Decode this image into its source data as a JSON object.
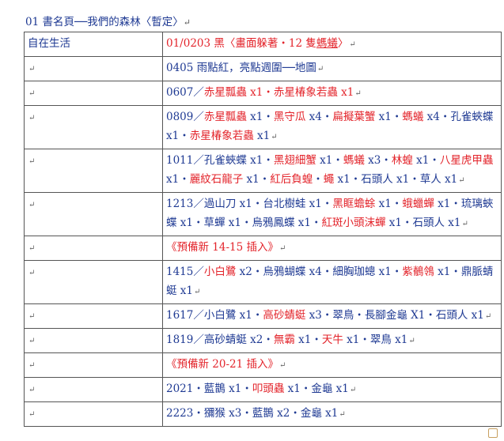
{
  "title": "01 書名頁──我們的森林〈暫定〉",
  "return_mark": "↵",
  "row_left": "自在生活",
  "rows": [
    {
      "type": "content",
      "segments": [
        {
          "t": "01/0203 ",
          "c": "red"
        },
        {
          "t": "黑〈畫面躲著・12 隻",
          "c": "red"
        },
        {
          "t": "螞蟻",
          "c": "red",
          "u": true
        },
        {
          "t": "〉",
          "c": "red"
        }
      ]
    },
    {
      "type": "content",
      "segments": [
        {
          "t": "0405 雨點紅，亮點週圍──地圖",
          "c": "blue"
        }
      ]
    },
    {
      "type": "content",
      "segments": [
        {
          "t": "0607／",
          "c": "blue"
        },
        {
          "t": "赤星瓢蟲 x1・赤星椿象若蟲 x1",
          "c": "red"
        }
      ]
    },
    {
      "type": "content",
      "segments": [
        {
          "t": "0809／",
          "c": "blue"
        },
        {
          "t": "赤星瓢蟲",
          "c": "red"
        },
        {
          "t": " x1・",
          "c": "blue"
        },
        {
          "t": "黑守瓜",
          "c": "red"
        },
        {
          "t": " x4・",
          "c": "blue"
        },
        {
          "t": "扁擬葉蟹",
          "c": "red"
        },
        {
          "t": " x1・",
          "c": "blue"
        },
        {
          "t": "螞蟻",
          "c": "red"
        },
        {
          "t": " x4・孔雀蛺蝶 x1・",
          "c": "blue"
        },
        {
          "t": "赤星椿象若蟲",
          "c": "red"
        },
        {
          "t": " x1",
          "c": "blue"
        }
      ]
    },
    {
      "type": "content",
      "segments": [
        {
          "t": "1011／孔雀蛺蝶 x1・",
          "c": "blue"
        },
        {
          "t": "黑翅細蟹",
          "c": "red"
        },
        {
          "t": " x1・",
          "c": "blue"
        },
        {
          "t": "螞蟻",
          "c": "red"
        },
        {
          "t": " x3・",
          "c": "blue"
        },
        {
          "t": "林蝗",
          "c": "red"
        },
        {
          "t": " x1・",
          "c": "blue"
        },
        {
          "t": "八星虎甲蟲",
          "c": "red"
        },
        {
          "t": " x1・",
          "c": "blue"
        },
        {
          "t": "麗紋石龍子",
          "c": "red"
        },
        {
          "t": " x1・",
          "c": "blue"
        },
        {
          "t": "紅后負蝗",
          "c": "red"
        },
        {
          "t": "・",
          "c": "blue"
        },
        {
          "t": "蠅",
          "c": "red"
        },
        {
          "t": " x1・石頭人 x1・草人 x1",
          "c": "blue"
        }
      ]
    },
    {
      "type": "content",
      "segments": [
        {
          "t": "1213／過山刀 x1・台北樹蛙 x1・",
          "c": "blue"
        },
        {
          "t": "黑眶蟾蜍",
          "c": "red"
        },
        {
          "t": " x1・",
          "c": "blue"
        },
        {
          "t": "蛾蠟蟬",
          "c": "red"
        },
        {
          "t": " x1・琉璃蛺蝶 x1・草蟬 x1・烏鴉鳳蝶 x1・",
          "c": "blue"
        },
        {
          "t": "紅斑小頭沫蟬",
          "c": "red"
        },
        {
          "t": " x1・石頭人 x1",
          "c": "blue"
        }
      ]
    },
    {
      "type": "pending",
      "segments": [
        {
          "t": "《預備新 14-15 插入》",
          "c": "red"
        }
      ]
    },
    {
      "type": "content",
      "segments": [
        {
          "t": "1415／",
          "c": "blue"
        },
        {
          "t": "小白鷺",
          "c": "red"
        },
        {
          "t": " x2・烏鴉蝴蝶 x4・細胸珈蟌 x1・",
          "c": "blue"
        },
        {
          "t": "紫鶺鴒",
          "c": "red"
        },
        {
          "t": " x1・鼎脈蜻蜓 x1",
          "c": "blue"
        }
      ]
    },
    {
      "type": "content",
      "segments": [
        {
          "t": "1617／小白鷺 x1・",
          "c": "blue"
        },
        {
          "t": "高砂蜻蜓",
          "c": "red"
        },
        {
          "t": " x3・翠鳥・長腳金龜 X1・石頭人 x1",
          "c": "blue"
        }
      ]
    },
    {
      "type": "content",
      "segments": [
        {
          "t": "1819／高砂蜻蜓 x2・",
          "c": "blue"
        },
        {
          "t": "無霸",
          "c": "red"
        },
        {
          "t": " x1・",
          "c": "blue"
        },
        {
          "t": "天牛",
          "c": "red"
        },
        {
          "t": " x1・翠鳥 x1",
          "c": "blue"
        }
      ]
    },
    {
      "type": "pending",
      "segments": [
        {
          "t": "《預備新 20-21 插入》",
          "c": "red"
        }
      ]
    },
    {
      "type": "content",
      "segments": [
        {
          "t": "2021・藍鵲 x1・",
          "c": "blue"
        },
        {
          "t": "叩頭蟲",
          "c": "red"
        },
        {
          "t": " x1・金龜 x1",
          "c": "blue"
        }
      ]
    },
    {
      "type": "content",
      "segments": [
        {
          "t": "2223・獼猴 x3・藍鵲 x2・金龜 x1",
          "c": "blue"
        }
      ]
    }
  ],
  "colors": {
    "blue": "#1f3a93",
    "red": "#e3242b"
  }
}
